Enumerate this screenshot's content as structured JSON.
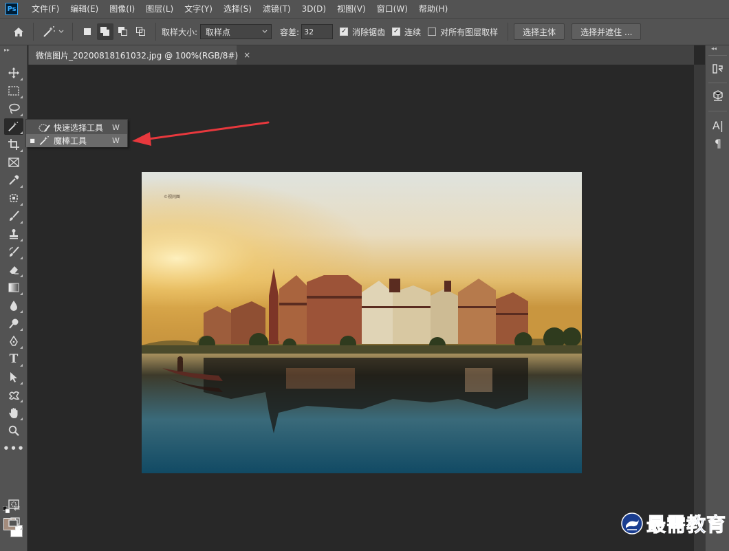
{
  "app": {
    "logo_text": "Ps"
  },
  "menubar": {
    "items": [
      "文件(F)",
      "编辑(E)",
      "图像(I)",
      "图层(L)",
      "文字(Y)",
      "选择(S)",
      "滤镜(T)",
      "3D(D)",
      "视图(V)",
      "窗口(W)",
      "帮助(H)"
    ]
  },
  "options": {
    "sample_size_label": "取样大小:",
    "sample_size_value": "取样点",
    "tolerance_label": "容差:",
    "tolerance_value": "32",
    "anti_alias_label": "消除锯齿",
    "anti_alias_checked": true,
    "contiguous_label": "连续",
    "contiguous_checked": true,
    "sample_all_label": "对所有图层取样",
    "sample_all_checked": false,
    "select_subject_label": "选择主体",
    "select_mask_label": "选择并遮住 ..."
  },
  "document": {
    "tab_title": "微信图片_20200818161032.jpg @ 100%(RGB/8#)",
    "close_glyph": "×"
  },
  "flyout": {
    "items": [
      {
        "label": "快速选择工具",
        "shortcut": "W",
        "selected": false
      },
      {
        "label": "魔棒工具",
        "shortcut": "W",
        "selected": true
      }
    ]
  },
  "colors": {
    "foreground": "#a38c7d",
    "background": "#ffffff",
    "arrow": "#e8383d"
  },
  "photo": {
    "corner_text": "©视问图"
  },
  "watermark": {
    "text": "最需教育"
  }
}
